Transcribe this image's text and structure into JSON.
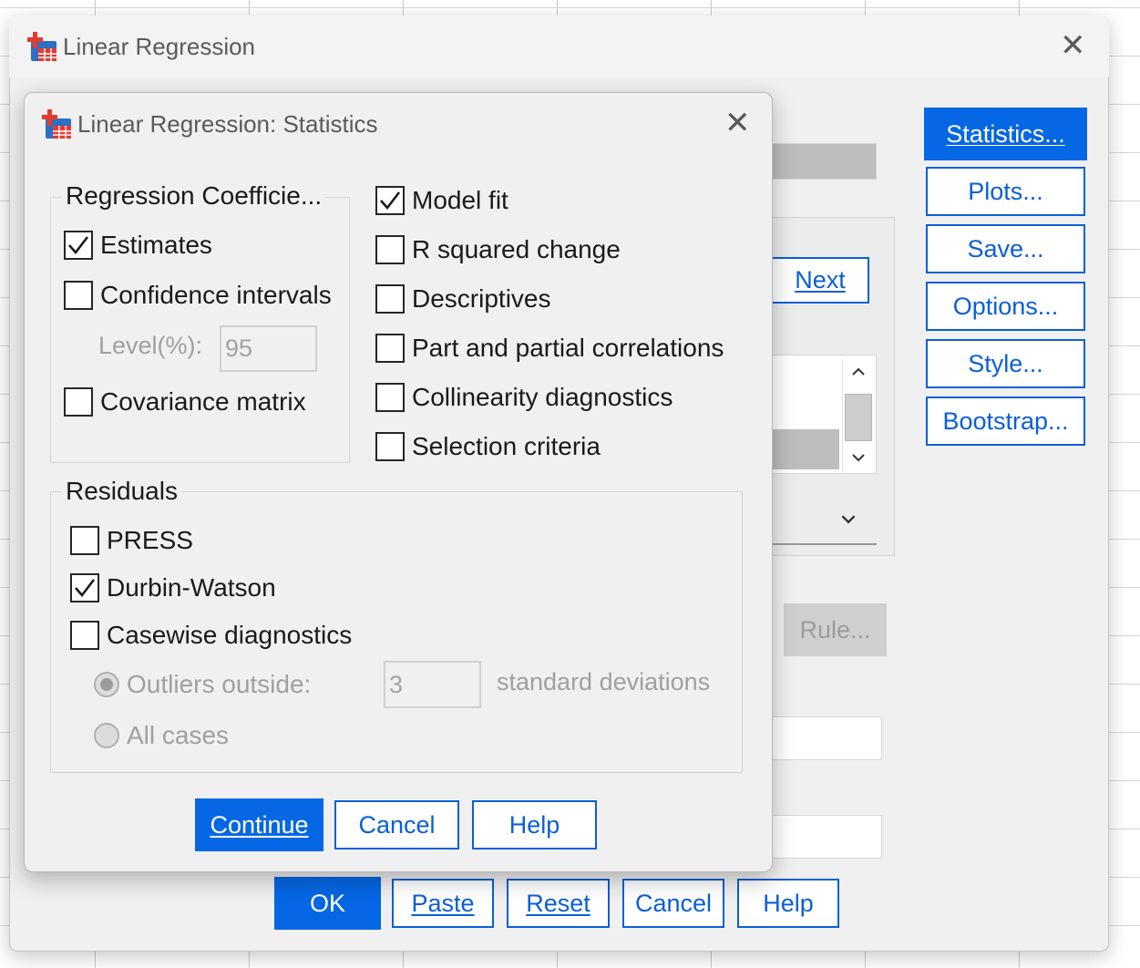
{
  "main_window": {
    "title": "Linear Regression",
    "side_buttons": [
      {
        "label": "Statistics...",
        "mnemonic_index": 0
      },
      {
        "label": "Plots...",
        "mnemonic_index": 3
      },
      {
        "label": "Save...",
        "mnemonic_index": 1
      },
      {
        "label": "Options...",
        "mnemonic_index": 0
      },
      {
        "label": "Style...",
        "mnemonic_index": 3
      },
      {
        "label": "Bootstrap...",
        "mnemonic_index": 0
      }
    ],
    "next_button": "Next",
    "rule_button": "Rule...",
    "bottom_buttons": {
      "ok": "OK",
      "paste": "Paste",
      "reset": "Reset",
      "cancel": "Cancel",
      "help": "Help"
    }
  },
  "stats_dialog": {
    "title": "Linear Regression: Statistics",
    "coefficients": {
      "legend": "Regression Coefficie...",
      "estimates": {
        "label": "Estimates",
        "checked": true
      },
      "confidence": {
        "label": "Confidence intervals",
        "checked": false
      },
      "level_label": "Level(%):",
      "level_value": "95",
      "covariance": {
        "label": "Covariance matrix",
        "checked": false
      }
    },
    "right_options": [
      {
        "label": "Model fit",
        "checked": true
      },
      {
        "label": "R squared change",
        "checked": false
      },
      {
        "label": "Descriptives",
        "checked": false
      },
      {
        "label": "Part and partial correlations",
        "checked": false
      },
      {
        "label": "Collinearity diagnostics",
        "checked": false
      },
      {
        "label": "Selection criteria",
        "checked": false
      }
    ],
    "residuals": {
      "legend": "Residuals",
      "press": {
        "label": "PRESS",
        "checked": false
      },
      "durbin": {
        "label": "Durbin-Watson",
        "checked": true
      },
      "casewise": {
        "label": "Casewise diagnostics",
        "checked": false
      },
      "outliers_label": "Outliers outside:",
      "outliers_value": "3",
      "std_label": "standard deviations",
      "all_cases_label": "All cases"
    },
    "buttons": {
      "continue": "Continue",
      "cancel": "Cancel",
      "help": "Help"
    }
  },
  "colors": {
    "accent": "#0567e3",
    "button_border": "#0a5fd6",
    "dialog_bg": "#f0f0f0"
  }
}
